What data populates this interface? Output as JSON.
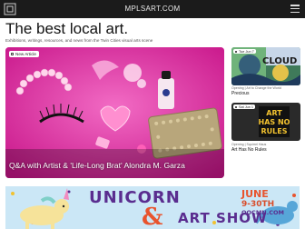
{
  "header": {
    "site_name": "MPLSART.COM",
    "logo_icon": "mplsart-logo-icon",
    "menu_icon": "hamburger-menu-icon",
    "background": "#1b1b1b"
  },
  "hero": {
    "headline": "The best local art.",
    "tagline": "Exhibitions, writings, resources, and news from the Twin Cities visual arts scene"
  },
  "featured": {
    "badge": "New Article",
    "title": "Q&A with Artist & 'Life-Long Brat' Alondra M. Garza",
    "accent": "#e93aa8"
  },
  "side_cards": [
    {
      "badge": "Tue Jun 7",
      "meta": "Opening | Art to Change the World",
      "title": "Precious"
    },
    {
      "badge": "Sat Jun 1",
      "meta": "Opening | Squirrel Haus",
      "title": "Art Has No Rules",
      "image_text": "ART HAS NO RULES"
    }
  ],
  "banner": {
    "line1": "UNICORN",
    "amp": "&",
    "line2": "ART SHOW",
    "date_month": "JUNE",
    "date_range": "9-30TH",
    "site": "OOCMN.COM"
  }
}
